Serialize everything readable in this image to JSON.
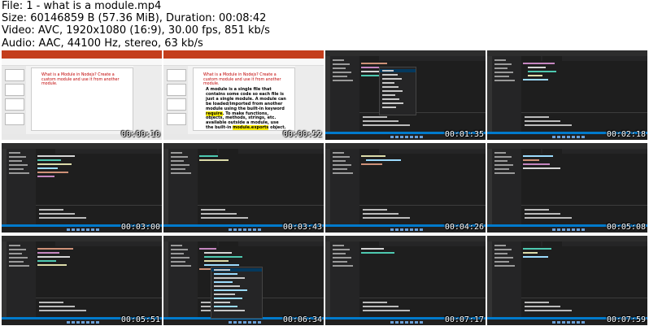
{
  "header": {
    "file_line": "File: 1 - what is a module.mp4",
    "size_line": "Size: 60146859 B (57.36 MiB), Duration: 00:08:42",
    "video_line": "Video: AVC, 1920x1080 (16:9), 30.00 fps, 851 kb/s",
    "audio_line": "Audio: AAC, 44100 Hz, stereo, 63 kb/s"
  },
  "slide": {
    "title": "What is a Module in Nodejs? Create a custom module and use it from another module.",
    "body_pre": "A module is a single file that contains some code so each file is just a single module. A module can be loaded/imported from another module using the built-in keyword ",
    "body_kw1": "require",
    "body_mid": ". To make functions, objects, methods, strings, etc. available outside a module, use the built-in ",
    "body_kw2": "module.exports",
    "body_post": " object."
  },
  "thumbnails": [
    {
      "timestamp": "00:00:10",
      "kind": "slide-title"
    },
    {
      "timestamp": "00:00:52",
      "kind": "slide-full"
    },
    {
      "timestamp": "00:01:35",
      "kind": "vscode-dropdown"
    },
    {
      "timestamp": "00:02:18",
      "kind": "vscode"
    },
    {
      "timestamp": "00:03:00",
      "kind": "vscode"
    },
    {
      "timestamp": "00:03:43",
      "kind": "vscode"
    },
    {
      "timestamp": "00:04:26",
      "kind": "vscode"
    },
    {
      "timestamp": "00:05:08",
      "kind": "vscode"
    },
    {
      "timestamp": "00:05:51",
      "kind": "vscode"
    },
    {
      "timestamp": "00:06:34",
      "kind": "vscode-autocomplete"
    },
    {
      "timestamp": "00:07:17",
      "kind": "vscode"
    },
    {
      "timestamp": "00:07:59",
      "kind": "vscode"
    }
  ]
}
